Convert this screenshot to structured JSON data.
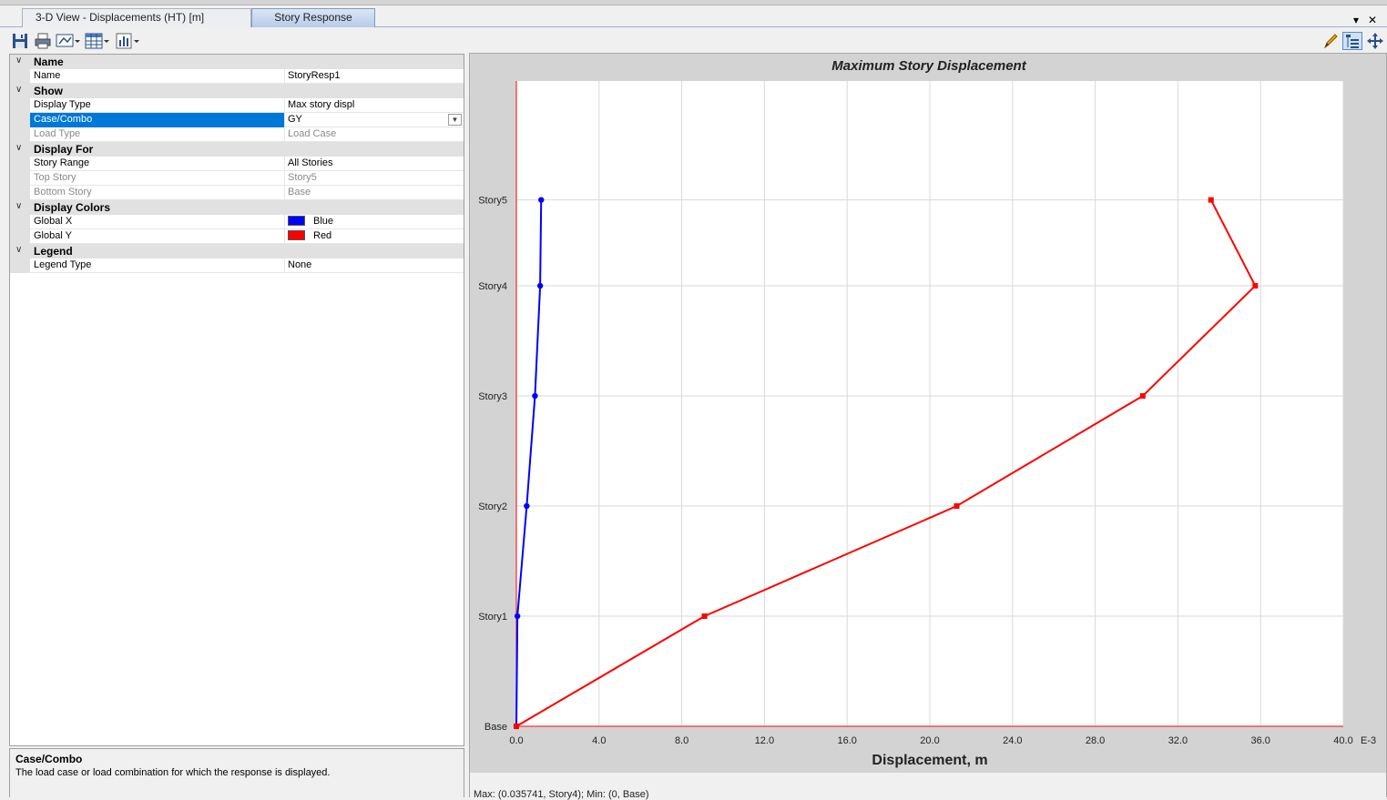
{
  "tabs": [
    {
      "label": "3-D View   - Displacements (HT)  [m]",
      "active": false
    },
    {
      "label": "Story Response",
      "active": true
    }
  ],
  "tab_controls": {
    "dropdown": "▾",
    "close": "✕"
  },
  "toolbar_icons": [
    "save-icon",
    "print-icon",
    "display-options-icon",
    "table-icon",
    "chart-icon",
    "pencil-icon",
    "tree-options-icon",
    "pan-icon"
  ],
  "properties": [
    {
      "kind": "category",
      "label": "Name"
    },
    {
      "kind": "prop",
      "name": "Name",
      "value": "StoryResp1"
    },
    {
      "kind": "category",
      "label": "Show"
    },
    {
      "kind": "prop",
      "name": "Display Type",
      "value": "Max story displ"
    },
    {
      "kind": "prop",
      "name": "Case/Combo",
      "value": "GY",
      "selected": true,
      "dropdown": true
    },
    {
      "kind": "prop",
      "name": "Load Type",
      "value": "Load Case",
      "dim": true
    },
    {
      "kind": "category",
      "label": "Display For"
    },
    {
      "kind": "prop",
      "name": "Story Range",
      "value": "All Stories"
    },
    {
      "kind": "prop",
      "name": "Top Story",
      "value": "Story5",
      "dim": true
    },
    {
      "kind": "prop",
      "name": "Bottom Story",
      "value": "Base",
      "dim": true
    },
    {
      "kind": "category",
      "label": "Display Colors"
    },
    {
      "kind": "prop",
      "name": "Global X",
      "value": "Blue",
      "swatch": "#0000ff"
    },
    {
      "kind": "prop",
      "name": "Global Y",
      "value": "Red",
      "swatch": "#ff0000"
    },
    {
      "kind": "category",
      "label": "Legend"
    },
    {
      "kind": "prop",
      "name": "Legend Type",
      "value": "None"
    }
  ],
  "description": {
    "title": "Case/Combo",
    "text": "The load case or load combination for which the response is displayed."
  },
  "status": {
    "text": "Max: (0.035741, Story4);   Min: (0, Base)"
  },
  "chart_data": {
    "type": "line",
    "title": "Maximum Story Displacement",
    "xlabel": "Displacement, m",
    "ylabel": "",
    "x_unit_suffix": "E-3",
    "xlim": [
      0,
      40
    ],
    "x_ticks": [
      "0.0",
      "4.0",
      "8.0",
      "12.0",
      "16.0",
      "20.0",
      "24.0",
      "28.0",
      "32.0",
      "36.0",
      "40.0"
    ],
    "stories": [
      "Base",
      "Story1",
      "Story2",
      "Story3",
      "Story4",
      "Story5"
    ],
    "story_levels": [
      0,
      1,
      2,
      3,
      4,
      5
    ],
    "story_elevations": [
      0,
      1,
      2,
      3,
      4,
      4.78
    ],
    "grid": true,
    "series": [
      {
        "name": "Global X",
        "color": "#0000ff",
        "marker": "circle",
        "values": [
          0,
          0.05,
          0.5,
          0.9,
          1.15,
          1.2
        ]
      },
      {
        "name": "Global Y",
        "color": "#ff0000",
        "marker": "square",
        "values": [
          0,
          9.1,
          21.3,
          30.3,
          35.741,
          33.6
        ]
      }
    ]
  }
}
